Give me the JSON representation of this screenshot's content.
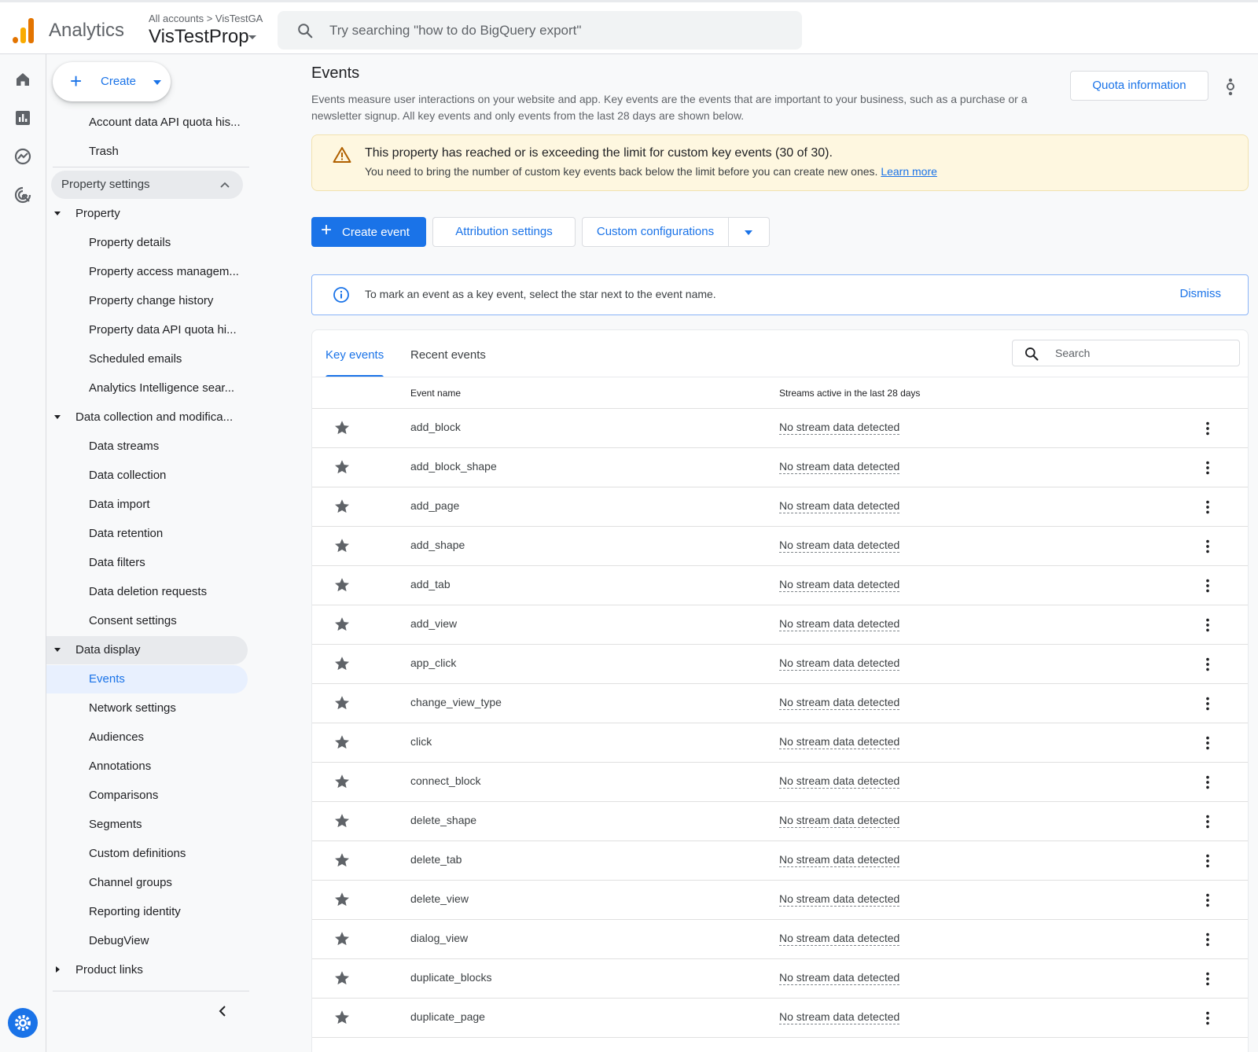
{
  "header": {
    "app_name": "Analytics",
    "breadcrumb": "All accounts > VisTestGA",
    "property_name": "VisTestProp",
    "search_placeholder": "Try searching \"how to do BigQuery export\""
  },
  "sidenav": {
    "create_label": "Create",
    "top_items": [
      "Account data API quota his...",
      "Trash"
    ],
    "section_label": "Property settings",
    "groups": [
      {
        "label": "Property",
        "items": [
          "Property details",
          "Property access managem...",
          "Property change history",
          "Property data API quota hi...",
          "Scheduled emails",
          "Analytics Intelligence sear..."
        ]
      },
      {
        "label": "Data collection and modifica...",
        "items": [
          "Data streams",
          "Data collection",
          "Data import",
          "Data retention",
          "Data filters",
          "Data deletion requests",
          "Consent settings"
        ]
      },
      {
        "label": "Data display",
        "items": [
          "Events",
          "Network settings",
          "Audiences",
          "Annotations",
          "Comparisons",
          "Segments",
          "Custom definitions",
          "Channel groups",
          "Reporting identity",
          "DebugView"
        ]
      },
      {
        "label": "Product links"
      }
    ],
    "active_item": "Events"
  },
  "main": {
    "title": "Events",
    "description": "Events measure user interactions on your website and app. Key events are the events that are important to your business, such as a purchase or a newsletter signup. All key events and only events from the last 28 days are shown below.",
    "quota_button": "Quota information",
    "warning": {
      "title": "This property has reached or is exceeding the limit for custom key events (30 of 30).",
      "body": "You need to bring the number of custom key events back below the limit before you can create new ones.",
      "link": "Learn more"
    },
    "buttons": {
      "create_event": "Create event",
      "attribution": "Attribution settings",
      "custom_config": "Custom configurations"
    },
    "info": {
      "text": "To mark an event as a key event, select the star next to the event name.",
      "dismiss": "Dismiss"
    },
    "tabs": [
      "Key events",
      "Recent events"
    ],
    "table_search_placeholder": "Search",
    "columns": [
      "Event name",
      "Streams active in the last 28 days"
    ],
    "rows": [
      {
        "name": "add_block",
        "stream": "No stream data detected"
      },
      {
        "name": "add_block_shape",
        "stream": "No stream data detected"
      },
      {
        "name": "add_page",
        "stream": "No stream data detected"
      },
      {
        "name": "add_shape",
        "stream": "No stream data detected"
      },
      {
        "name": "add_tab",
        "stream": "No stream data detected"
      },
      {
        "name": "add_view",
        "stream": "No stream data detected"
      },
      {
        "name": "app_click",
        "stream": "No stream data detected"
      },
      {
        "name": "change_view_type",
        "stream": "No stream data detected"
      },
      {
        "name": "click",
        "stream": "No stream data detected"
      },
      {
        "name": "connect_block",
        "stream": "No stream data detected"
      },
      {
        "name": "delete_shape",
        "stream": "No stream data detected"
      },
      {
        "name": "delete_tab",
        "stream": "No stream data detected"
      },
      {
        "name": "delete_view",
        "stream": "No stream data detected"
      },
      {
        "name": "dialog_view",
        "stream": "No stream data detected"
      },
      {
        "name": "duplicate_blocks",
        "stream": "No stream data detected"
      },
      {
        "name": "duplicate_page",
        "stream": "No stream data detected"
      }
    ]
  },
  "colors": {
    "accent": "#1a73e8",
    "warning_bg": "#fef7e0",
    "logo_orange": "#e37400",
    "logo_yellow": "#f9ab00"
  }
}
